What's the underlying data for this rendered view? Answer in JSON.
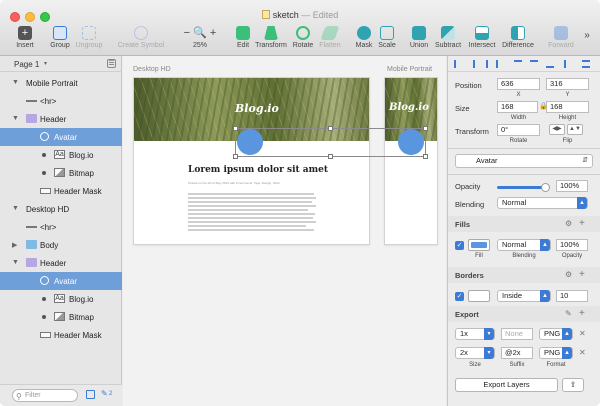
{
  "window": {
    "title": "sketch",
    "status": "Edited"
  },
  "toolbar": {
    "insert": "Insert",
    "group": "Group",
    "ungroup": "Ungroup",
    "create_symbol": "Create Symbol",
    "zoom_minus": "−",
    "zoom_plus": "+",
    "zoom": "25%",
    "edit": "Edit",
    "transform": "Transform",
    "rotate": "Rotate",
    "flatten": "Flatten",
    "mask": "Mask",
    "scale": "Scale",
    "union": "Union",
    "subtract": "Subtract",
    "intersect": "Intersect",
    "difference": "Difference",
    "forward": "Forward",
    "more": "»"
  },
  "sidebar": {
    "page": "Page 1",
    "filter_placeholder": "Filter",
    "layers": [
      {
        "label": "Mobile Portrait"
      },
      {
        "label": "<hr>"
      },
      {
        "label": "Header"
      },
      {
        "label": "Avatar"
      },
      {
        "label": "Blog.io"
      },
      {
        "label": "Bitmap"
      },
      {
        "label": "Header Mask"
      },
      {
        "label": "Desktop HD"
      },
      {
        "label": "<hr>"
      },
      {
        "label": "Body"
      },
      {
        "label": "Header"
      },
      {
        "label": "Avatar"
      },
      {
        "label": "Blog.io"
      },
      {
        "label": "Bitmap"
      },
      {
        "label": "Header Mask"
      }
    ],
    "text_icon_glyph": "Aa",
    "footer_count": "2"
  },
  "canvas": {
    "artboard_desktop": "Desktop HD",
    "artboard_mobile": "Mobile Portrait",
    "logo": "Blog.io",
    "logo_mobile": "Blog.io",
    "post_title": "Lorem ipsum dolor sit amet",
    "post_meta": "Posted on the 4th of May 2016 with 0 comments. Tags: Design, Work"
  },
  "inspector": {
    "position_label": "Position",
    "x": "636",
    "y": "316",
    "x_label": "X",
    "y_label": "Y",
    "size_label": "Size",
    "width": "168",
    "height": "168",
    "width_label": "Width",
    "height_label": "Height",
    "transform_label": "Transform",
    "rotate_value": "0°",
    "rotate_label": "Rotate",
    "flip_label": "Flip",
    "style": "Avatar",
    "opacity_label": "Opacity",
    "opacity": "100%",
    "opacity_level": 1.0,
    "blending_label": "Blending",
    "blending": "Normal",
    "fills_title": "Fills",
    "fill_color": "#5a96df",
    "fill_blending": "Normal",
    "fill_opacity": "100%",
    "fill_label": "Fill",
    "fill_blending_label": "Blending",
    "fill_opacity_label": "Opacity",
    "borders_title": "Borders",
    "border_position": "Inside",
    "border_width": "10",
    "export_title": "Export",
    "export_rows": [
      {
        "scale": "1x",
        "suffix": "None",
        "format": "PNG"
      },
      {
        "scale": "2x",
        "suffix": "@2x",
        "format": "PNG"
      }
    ],
    "export_size_label": "Size",
    "export_suffix_label": "Suffix",
    "export_format_label": "Format",
    "export_button": "Export Layers"
  }
}
